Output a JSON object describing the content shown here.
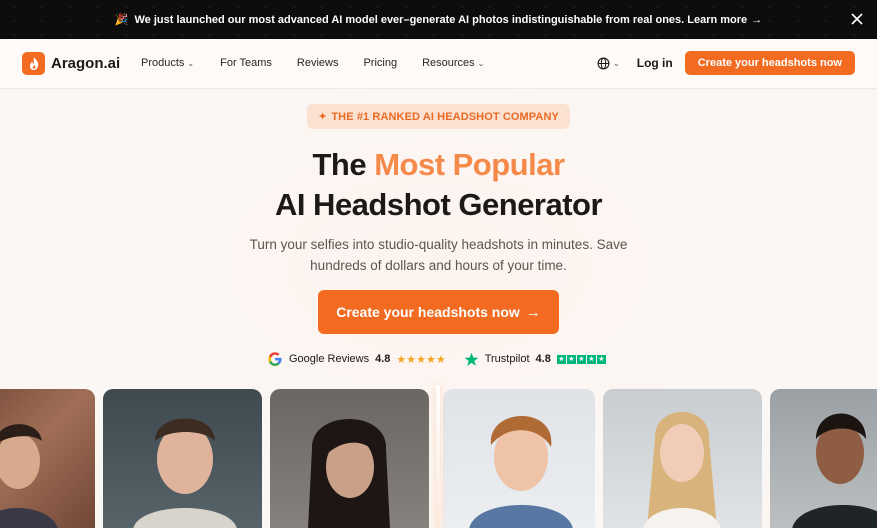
{
  "announcement": {
    "text": "We just launched our most advanced AI model ever–generate AI photos indistinguishable from real ones. Learn more",
    "arrow": "→",
    "icon": "party-popper-icon"
  },
  "nav": {
    "brand": "Aragon.ai",
    "items": [
      {
        "label": "Products",
        "dropdown": true
      },
      {
        "label": "For Teams",
        "dropdown": false
      },
      {
        "label": "Reviews",
        "dropdown": false
      },
      {
        "label": "Pricing",
        "dropdown": false
      },
      {
        "label": "Resources",
        "dropdown": true
      }
    ],
    "login": "Log in",
    "cta": "Create your headshots now"
  },
  "hero": {
    "badge": "THE #1 RANKED AI HEADSHOT COMPANY",
    "title_line1_prefix": "The ",
    "title_line1_accent": "Most Popular",
    "title_line2": "AI Headshot Generator",
    "subtitle": "Turn your selfies into studio-quality headshots in minutes. Save hundreds of dollars and hours of your time.",
    "cta": "Create your headshots now",
    "cta_arrow": "→"
  },
  "ratings": [
    {
      "source": "Google Reviews",
      "score": "4.8"
    },
    {
      "source": "Trustpilot",
      "score": "4.8"
    }
  ],
  "colors": {
    "brand": "#f26b21",
    "accent_text": "#f5894a",
    "badge_bg": "#fbe1d1",
    "trustpilot": "#00b67a",
    "google_star": "#f5a623"
  }
}
